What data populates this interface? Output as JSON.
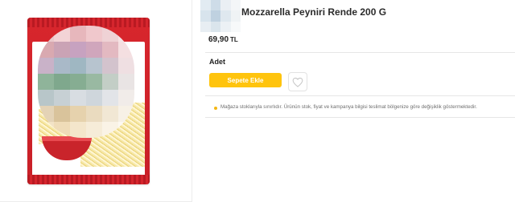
{
  "product": {
    "title": "Mozzarella Peyniri Rende 200 G",
    "price": "69,90",
    "currency": "TL",
    "image": {
      "description_icon": "cheese-package-image",
      "pack_color": "#d8262d"
    }
  },
  "purchase": {
    "qty_label": "Adet",
    "add_to_cart_label": "Sepete Ekle",
    "favorite_icon": "heart-icon",
    "accent_color": "#ffc40d"
  },
  "notice": {
    "icon": "info-dot-icon",
    "text": "Mağaza stoklarıyla sınırlıdır. Ürünün stok, fiyat ve kampanya bilgisi teslimat bölgenize göre değişiklik göstermektedir."
  }
}
